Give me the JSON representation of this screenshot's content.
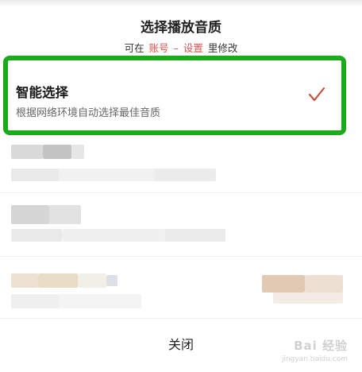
{
  "dialog": {
    "title": "选择播放音质",
    "subtitle_prefix": "可在",
    "subtitle_link_account": "账号",
    "subtitle_separator": "–",
    "subtitle_link_settings": "设置",
    "subtitle_suffix": "里修改"
  },
  "options": [
    {
      "label": "智能选择",
      "description": "根据网络环境自动选择最佳音质",
      "selected": true,
      "icon": "checkmark-icon"
    }
  ],
  "close_label": "关闭",
  "watermark": {
    "main": "Bai 经验",
    "sub": "jingyan.baidu.com"
  },
  "colors": {
    "highlight_border": "#1aaa1a",
    "link": "#d9534f",
    "checkmark": "#c9503f"
  }
}
